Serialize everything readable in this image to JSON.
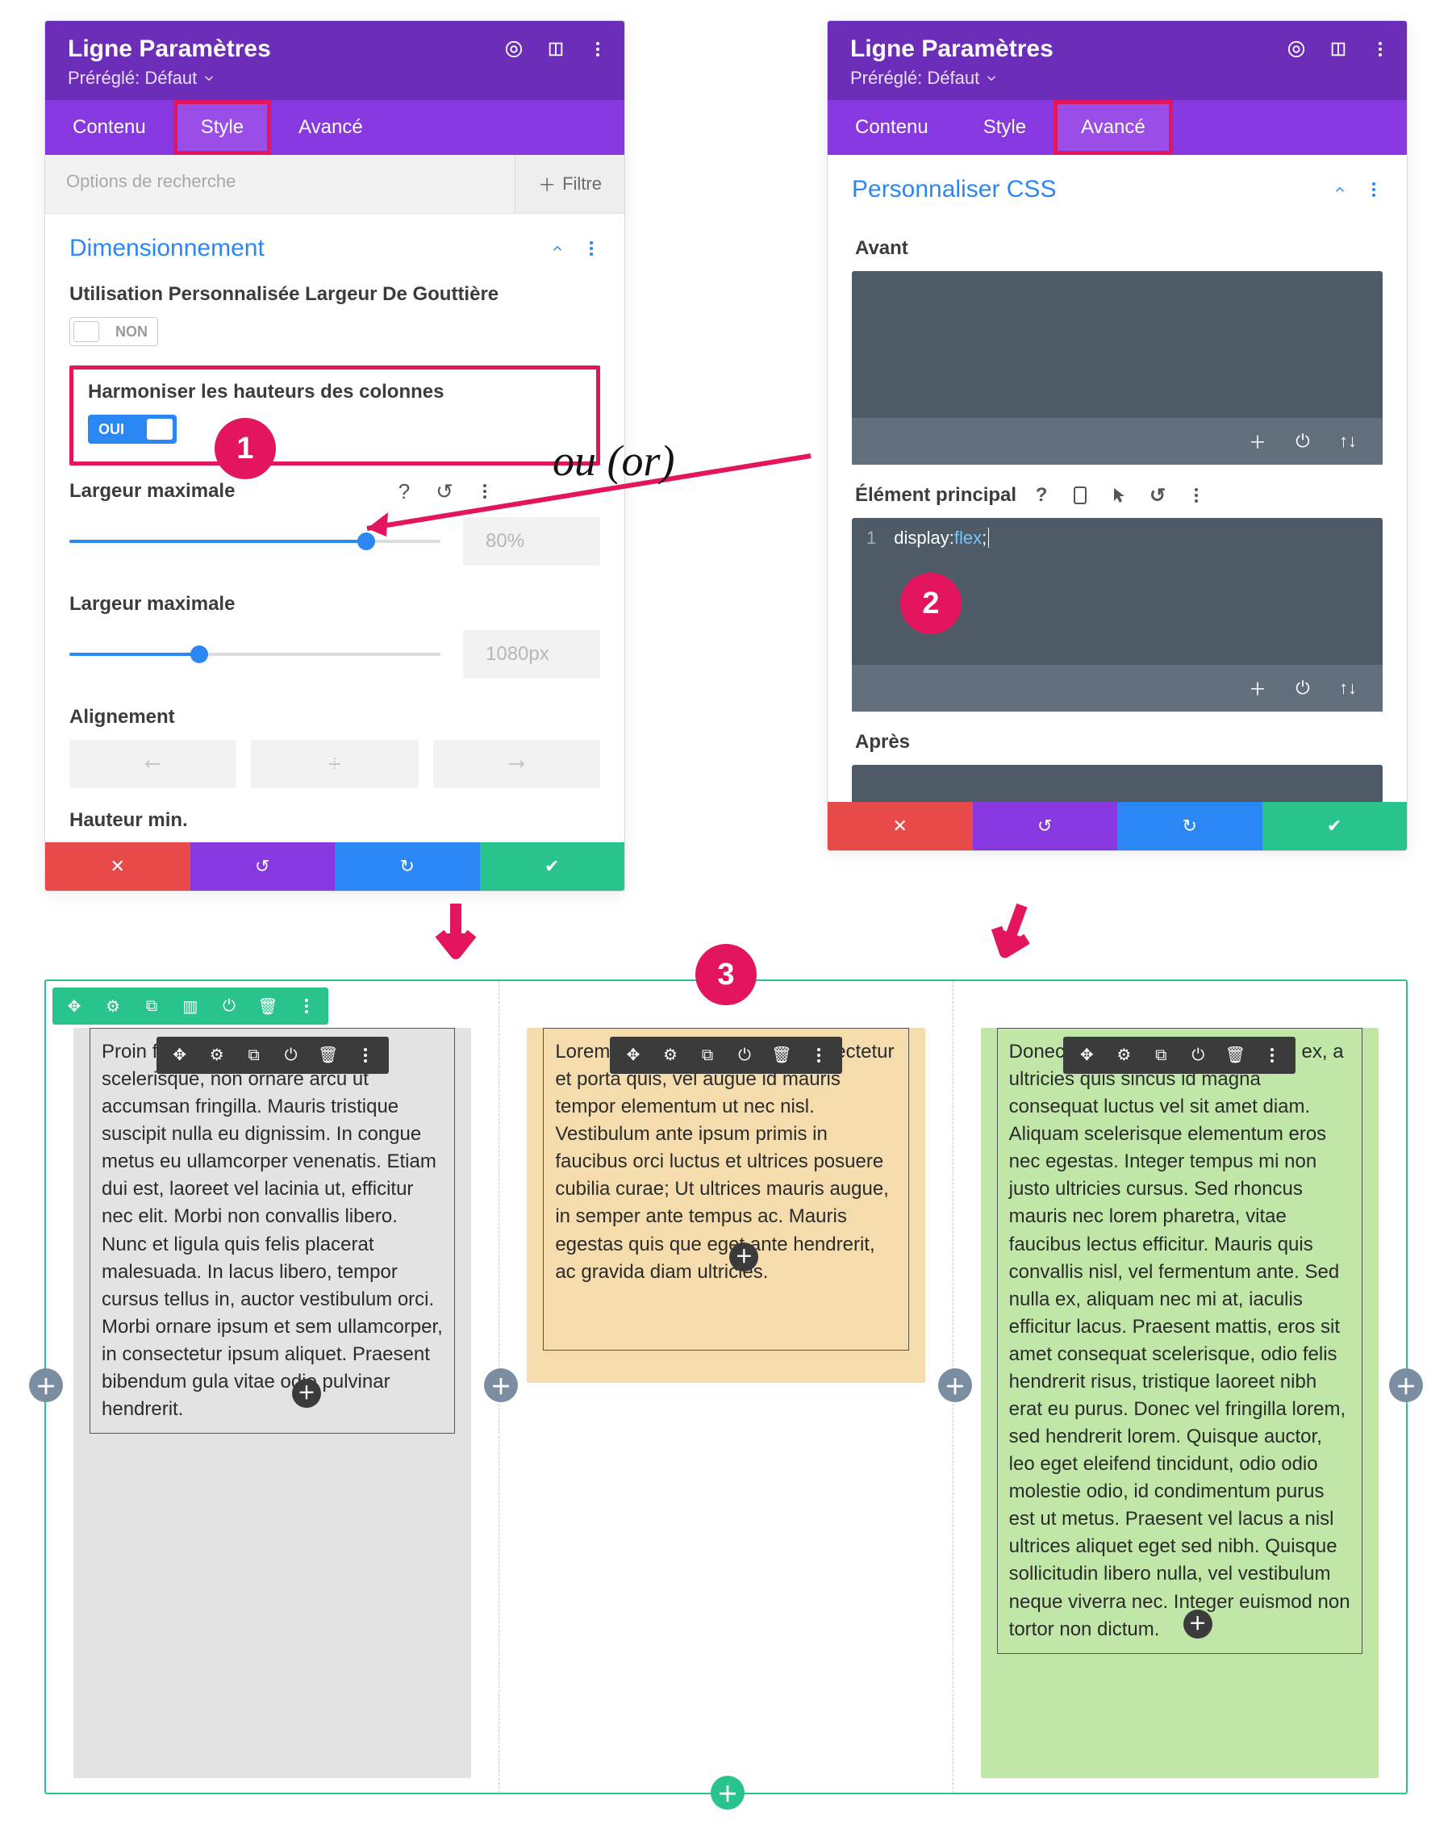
{
  "left": {
    "title": "Ligne Paramètres",
    "preset_label": "Préréglé: Défaut",
    "tabs": {
      "content": "Contenu",
      "style": "Style",
      "advanced": "Avancé"
    },
    "search_placeholder": "Options de recherche",
    "filter_label": "Filtre",
    "section_title": "Dimensionnement",
    "gutter_label": "Utilisation Personnalisée Largeur De Gouttière",
    "gutter_value": "NON",
    "equalize_label": "Harmoniser les hauteurs des colonnes",
    "equalize_value": "OUI",
    "width1_label": "Largeur maximale",
    "width1_value": "80%",
    "width1_percent": 80,
    "width2_label": "Largeur maximale",
    "width2_value": "1080px",
    "width2_percent": 35,
    "align_label": "Alignement",
    "minheight_label": "Hauteur min."
  },
  "right": {
    "title": "Ligne Paramètres",
    "preset_label": "Préréglé: Défaut",
    "tabs": {
      "content": "Contenu",
      "style": "Style",
      "advanced": "Avancé"
    },
    "section_title": "Personnaliser CSS",
    "before_label": "Avant",
    "main_label": "Élément principal",
    "after_label": "Après",
    "css_line_num": "1",
    "css_key": "display:",
    "css_val": "flex",
    "css_semi": ";"
  },
  "annotations": {
    "or_text": "ou (or)",
    "badge1": "1",
    "badge2": "2",
    "badge3": "3"
  },
  "columns": {
    "c1": "Proin finibus lectus eget leo scelerisque, non ornare arcu ut accumsan fringilla. Mauris tristique suscipit nulla eu dignissim. In congue metus eu ullamcorper venenatis. Etiam dui est, laoreet vel lacinia ut, efficitur nec elit. Morbi non convallis libero. Nunc et ligula quis felis placerat malesuada. In lacus libero, tempor cursus tellus in, auctor vestibulum orci. Morbi ornare ipsum et sem ullamcorper, in consectetur ipsum aliquet. Praesent bibendum gula vitae odio pulvinar hendrerit.",
    "c2": "Lorem ipsum dolor sit amet consectetur et porta quis, vel augue id mauris tempor elementum ut nec nisl. Vestibulum ante ipsum primis in faucibus orci luctus et ultrices posuere cubilia curae; Ut ultrices mauris augue, in semper ante tempus ac. Mauris egestas quis que eget ante hendrerit, ac gravida diam ultricies.",
    "c3": "Donec libero eros sit amet sapien ex, a ultricies quis sincus id magna consequat luctus vel sit amet diam. Aliquam scelerisque elementum eros nec egestas. Integer tempus mi non justo ultricies cursus. Sed rhoncus mauris nec lorem pharetra, vitae faucibus lectus efficitur. Mauris quis convallis nisl, vel fermentum ante. Sed nulla ex, aliquam nec mi at, iaculis efficitur lacus. Praesent mattis, eros sit amet consequat scelerisque, odio felis hendrerit risus, tristique laoreet nibh erat eu purus. Donec vel fringilla lorem, sed hendrerit lorem. Quisque auctor, leo eget eleifend tincidunt, odio odio molestie odio, id condimentum purus est ut metus. Praesent vel lacus a nisl ultrices aliquet eget sed nibh. Quisque sollicitudin libero nulla, vel vestibulum neque viverra nec. Integer euismod non tortor non dictum."
  }
}
